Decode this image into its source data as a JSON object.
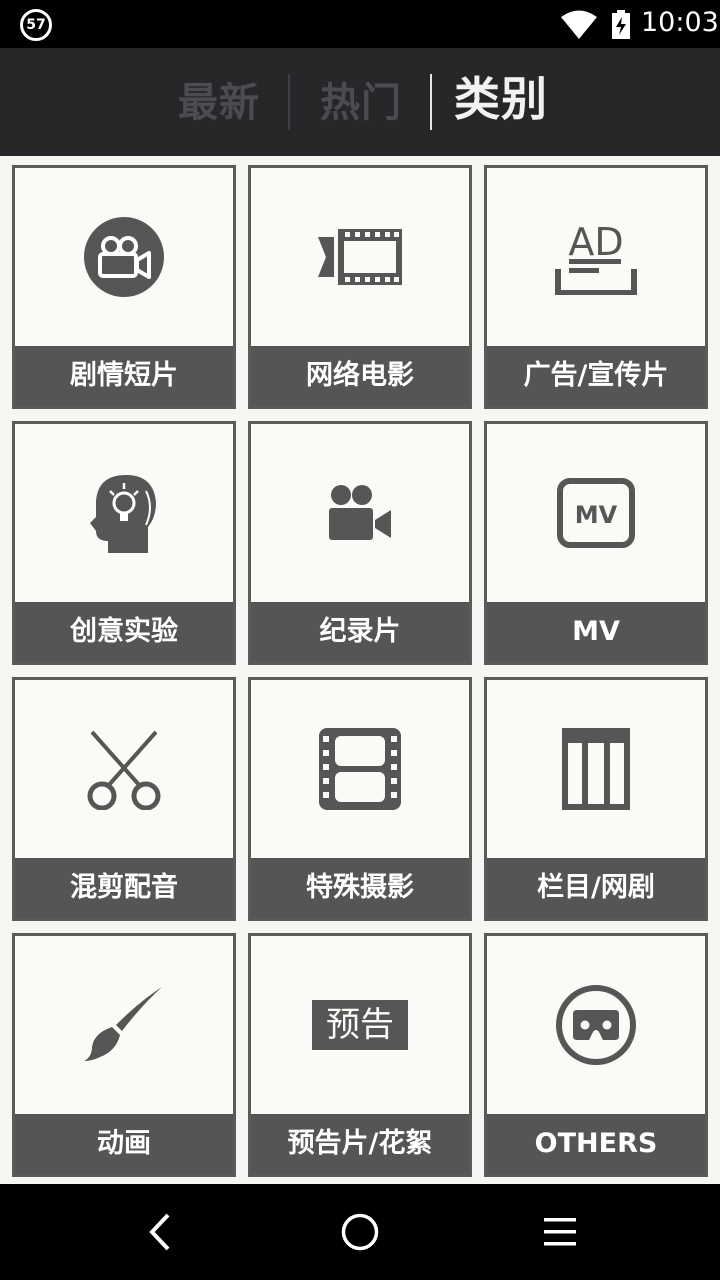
{
  "status": {
    "badge": "57",
    "time": "10:03"
  },
  "tabs": [
    {
      "label": "最新",
      "active": false
    },
    {
      "label": "热门",
      "active": false
    },
    {
      "label": "类别",
      "active": true
    }
  ],
  "categories": [
    {
      "label": "剧情短片",
      "icon": "video-camera-circle-icon"
    },
    {
      "label": "网络电影",
      "icon": "film-strip-icon"
    },
    {
      "label": "广告/宣传片",
      "icon": "ad-icon"
    },
    {
      "label": "创意实验",
      "icon": "lightbulb-head-icon"
    },
    {
      "label": "纪录片",
      "icon": "video-camera-icon"
    },
    {
      "label": "MV",
      "icon": "mv-icon"
    },
    {
      "label": "混剪配音",
      "icon": "scissors-icon"
    },
    {
      "label": "特殊摄影",
      "icon": "film-frame-icon"
    },
    {
      "label": "栏目/网剧",
      "icon": "columns-icon"
    },
    {
      "label": "动画",
      "icon": "paintbrush-icon"
    },
    {
      "label": "预告片/花絮",
      "icon": "trailer-icon",
      "icon_text": "预告"
    },
    {
      "label": "OTHERS",
      "icon": "vr-goggles-icon"
    }
  ],
  "ad_icon_text": "AD",
  "mv_icon_text": "MV",
  "colors": {
    "accent": "#545554",
    "tabbar": "#262729",
    "tile_bg": "#fafaf7"
  }
}
